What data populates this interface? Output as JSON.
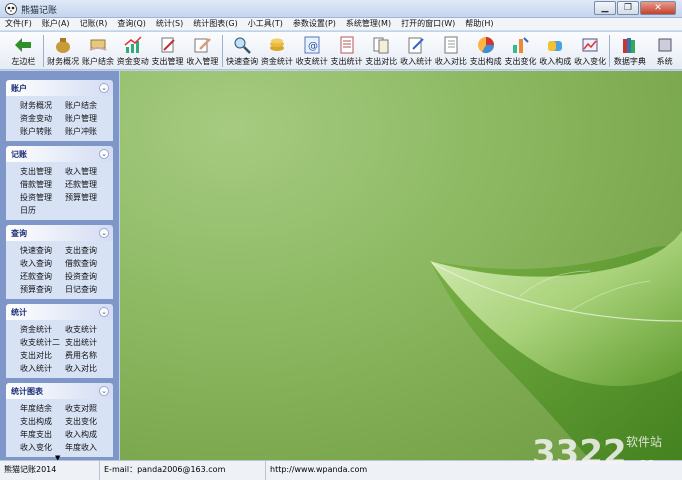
{
  "window": {
    "title": "熊猫记账"
  },
  "menu": [
    "文件(F)",
    "账户(A)",
    "记账(R)",
    "查询(Q)",
    "统计(S)",
    "统计图表(G)",
    "小工具(T)",
    "参数设置(P)",
    "系统管理(M)",
    "打开的窗口(W)",
    "帮助(H)"
  ],
  "toolbar": [
    {
      "label": "左边栏",
      "icon": "left-arrow-icon"
    },
    {
      "label": "财务概况",
      "icon": "money-bag-icon"
    },
    {
      "label": "账户结余",
      "icon": "hand-money-icon"
    },
    {
      "label": "资金变动",
      "icon": "chart-up-icon"
    },
    {
      "label": "支出管理",
      "icon": "pen-edit-icon"
    },
    {
      "label": "收入管理",
      "icon": "pencil-note-icon"
    },
    {
      "label": "快速查询",
      "icon": "magnifier-icon"
    },
    {
      "label": "资金统计",
      "icon": "coins-icon"
    },
    {
      "label": "收支统计",
      "icon": "at-doc-icon"
    },
    {
      "label": "支出统计",
      "icon": "list-doc-icon"
    },
    {
      "label": "支出对比",
      "icon": "compare-doc-icon"
    },
    {
      "label": "收入统计",
      "icon": "write-doc-icon"
    },
    {
      "label": "收入对比",
      "icon": "notebook-icon"
    },
    {
      "label": "支出构成",
      "icon": "pie-chart-icon"
    },
    {
      "label": "支出变化",
      "icon": "bar-change-icon"
    },
    {
      "label": "收入构成",
      "icon": "cylinder-chart-icon"
    },
    {
      "label": "收入变化",
      "icon": "line-change-icon"
    },
    {
      "label": "数据字典",
      "icon": "books-icon"
    },
    {
      "label": "系统",
      "icon": "system-icon"
    }
  ],
  "panel": [
    {
      "title": "账户",
      "links": [
        "财务概况",
        "账户结余",
        "资金变动",
        "账户管理",
        "账户转账",
        "账户冲账"
      ]
    },
    {
      "title": "记账",
      "links": [
        "支出管理",
        "收入管理",
        "借款管理",
        "还款管理",
        "投资管理",
        "预算管理",
        "日历"
      ]
    },
    {
      "title": "查询",
      "links": [
        "快速查询",
        "支出查询",
        "收入查询",
        "借款查询",
        "还款查询",
        "投资查询",
        "预算查询",
        "日记查询"
      ]
    },
    {
      "title": "统计",
      "links": [
        "资金统计",
        "收支统计",
        "收支统计二",
        "支出统计",
        "支出对比",
        "费用名称",
        "收入统计",
        "收入对比"
      ]
    },
    {
      "title": "统计图表",
      "links": [
        "年度结余",
        "收支对照",
        "支出构成",
        "支出变化",
        "年度支出",
        "收入构成",
        "收入变化",
        "年度收入"
      ]
    }
  ],
  "status": [
    "熊猫记账2014",
    "E-mail：panda2006@163.com",
    "http://www.wpanda.com"
  ],
  "watermark": {
    "digits": "3322",
    "cn": "软件站",
    "cc": ".cc"
  }
}
